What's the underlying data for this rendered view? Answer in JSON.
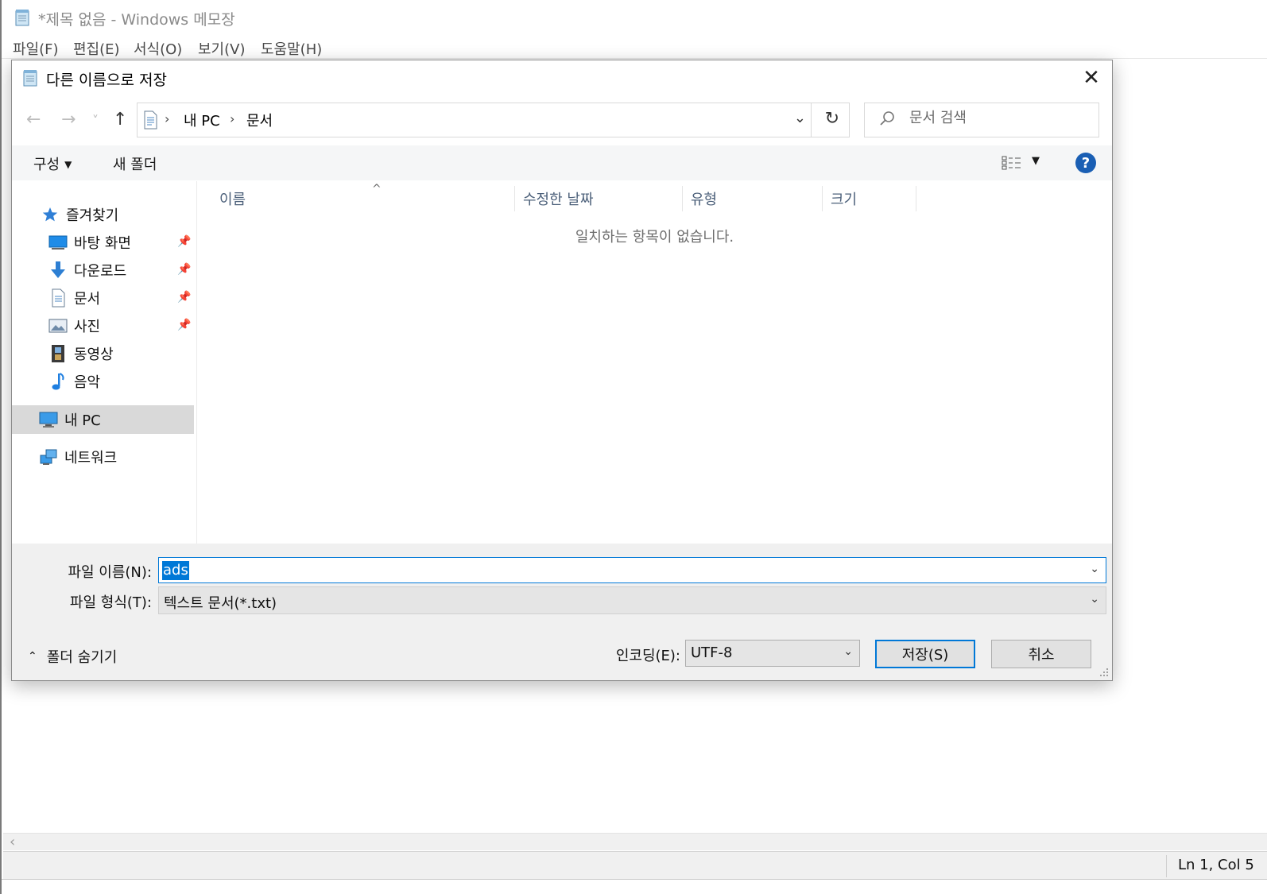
{
  "notepad": {
    "title": "*제목 없음 - Windows 메모장",
    "menu": [
      "파일(F)",
      "편집(E)",
      "서식(O)",
      "보기(V)",
      "도움말(H)"
    ],
    "status_position": "Ln 1, Col 5"
  },
  "dialog": {
    "title": "다른 이름으로 저장",
    "close_label": "✕",
    "nav": {
      "back": "←",
      "forward": "→",
      "recent": "˅",
      "up": "↑"
    },
    "address": {
      "segments": [
        "내 PC",
        "문서"
      ],
      "separator": "›",
      "dropdown": "⌄",
      "refresh": "↻"
    },
    "search": {
      "placeholder": "문서 검색",
      "icon": "⌕"
    },
    "toolbar": {
      "organize": "구성",
      "new_folder": "새 폴더",
      "view_caret": "▾",
      "help": "?"
    },
    "navpane": {
      "quick_access": "즐겨찾기",
      "items": [
        {
          "label": "바탕 화면",
          "icon": "desktop-icon",
          "pinned": true
        },
        {
          "label": "다운로드",
          "icon": "download-icon",
          "pinned": true
        },
        {
          "label": "문서",
          "icon": "document-icon",
          "pinned": true
        },
        {
          "label": "사진",
          "icon": "pictures-icon",
          "pinned": true
        },
        {
          "label": "동영상",
          "icon": "videos-icon",
          "pinned": false
        },
        {
          "label": "음악",
          "icon": "music-icon",
          "pinned": false
        }
      ],
      "this_pc": "내 PC",
      "network": "네트워크"
    },
    "filelist": {
      "columns": [
        "이름",
        "수정한 날짜",
        "유형",
        "크기"
      ],
      "sort_indicator": "^",
      "empty_message": "일치하는 항목이 없습니다."
    },
    "form": {
      "filename_label": "파일 이름(N):",
      "filename_value": "ads",
      "filetype_label": "파일 형식(T):",
      "filetype_value": "텍스트 문서(*.txt)",
      "hide_folders": "폴더 숨기기",
      "encoding_label": "인코딩(E):",
      "encoding_value": "UTF-8",
      "save": "저장(S)",
      "cancel": "취소"
    }
  },
  "colors": {
    "accent": "#0078d7",
    "help_blue": "#1a5fb4",
    "selection_bg": "#d9d9d9",
    "bottom_panel": "#f0f0f0"
  }
}
